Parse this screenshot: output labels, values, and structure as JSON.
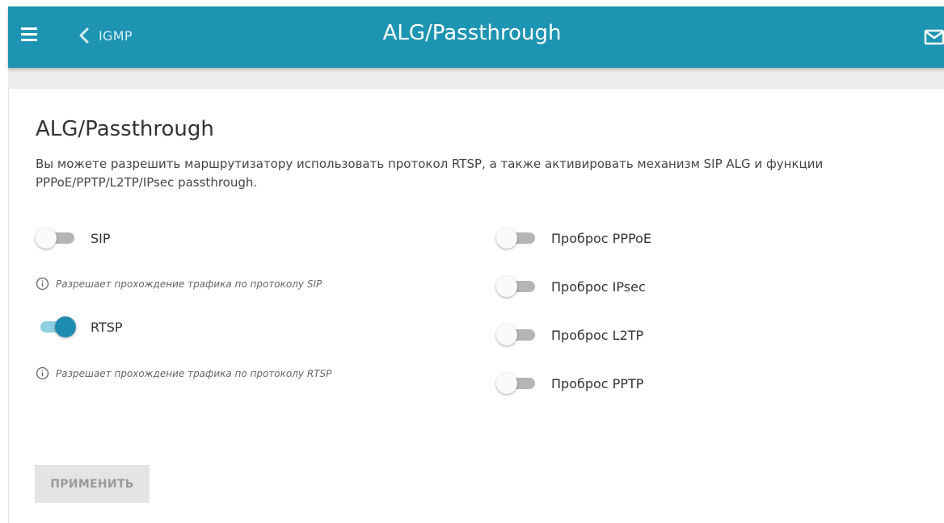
{
  "header": {
    "title": "ALG/Passthrough",
    "back_label": "IGMP",
    "color": "#1e94b3"
  },
  "main": {
    "title": "ALG/Passthrough",
    "description": "Вы можете разрешить маршрутизатору использовать протокол RTSP, а также активировать механизм SIP ALG и функции PPPoE/PPTP/L2TP/IPsec passthrough."
  },
  "left_toggles": [
    {
      "label": "SIP",
      "on": false,
      "hint": "Разрешает прохождение трафика по протоколу SIP"
    },
    {
      "label": "RTSP",
      "on": true,
      "hint": "Разрешает прохождение трафика по протоколу RTSP"
    }
  ],
  "right_toggles": [
    {
      "label": "Проброс PPPoE",
      "on": false
    },
    {
      "label": "Проброс IPsec",
      "on": false
    },
    {
      "label": "Проброс L2TP",
      "on": false
    },
    {
      "label": "Проброс PPTP",
      "on": false
    }
  ],
  "apply_button": {
    "label": "ПРИМЕНИТЬ",
    "disabled": true
  },
  "icons": {
    "menu": "hamburger-icon",
    "back": "chevron-left-icon",
    "mail": "mail-icon",
    "info": "info-icon"
  },
  "colors": {
    "accent": "#1e94b3",
    "toggle_on": "#1e8cb0",
    "toggle_off_track": "#b5b5b5"
  }
}
